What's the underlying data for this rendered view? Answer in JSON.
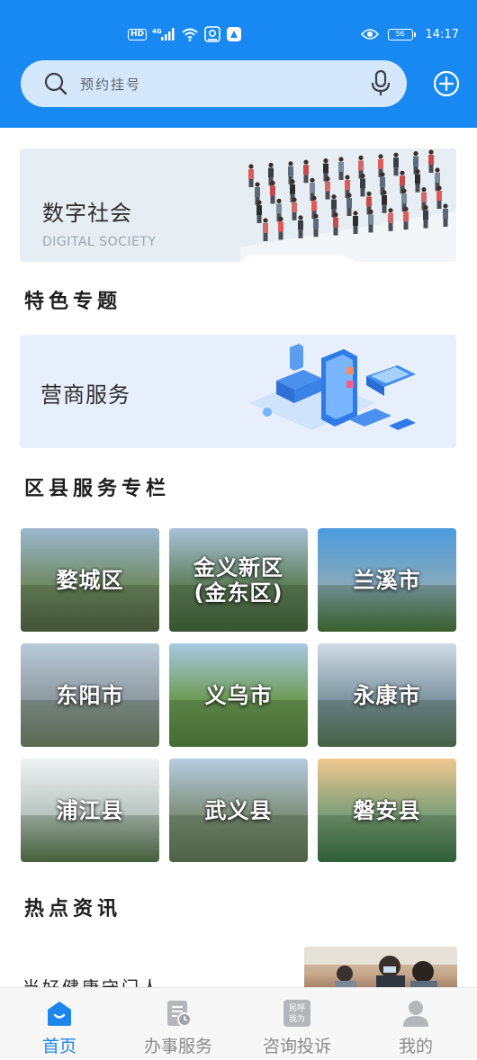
{
  "status_bar": {
    "left_badges": [
      "HD",
      "4G"
    ],
    "time": "14:17",
    "battery": "56"
  },
  "search": {
    "placeholder": "预约挂号"
  },
  "banner_digital": {
    "title": "数字社会",
    "subtitle": "DIGITAL SOCIETY"
  },
  "sections": {
    "featured_title": "特色专题",
    "district_title": "区县服务专栏",
    "news_title": "热点资讯"
  },
  "banner_business": {
    "title": "营商服务"
  },
  "districts": [
    {
      "name": "婺城区",
      "colors": [
        "#9cb7cf",
        "#6f8a63",
        "#4c5a3f"
      ]
    },
    {
      "name": "金义新区\n(金东区)",
      "colors": [
        "#a9c2d8",
        "#5f7f5a",
        "#3f5c37"
      ]
    },
    {
      "name": "兰溪市",
      "colors": [
        "#4b9be0",
        "#86a9b9",
        "#3e6b32"
      ]
    },
    {
      "name": "东阳市",
      "colors": [
        "#b9cad9",
        "#8e9aa0",
        "#6c7a63"
      ]
    },
    {
      "name": "义乌市",
      "colors": [
        "#a8c8e3",
        "#6d9b54",
        "#507a3a"
      ]
    },
    {
      "name": "永康市",
      "colors": [
        "#cfdbe6",
        "#7d95a0",
        "#4e6d55"
      ]
    },
    {
      "name": "浦江县",
      "colors": [
        "#eef2f2",
        "#b8c4c0",
        "#4f6c45"
      ]
    },
    {
      "name": "武义县",
      "colors": [
        "#b6cce0",
        "#7e8f7a",
        "#5d6f55"
      ]
    },
    {
      "name": "磐安县",
      "colors": [
        "#f0c78f",
        "#7a9e78",
        "#2f6b3c"
      ]
    }
  ],
  "news": [
    {
      "title": "当好健康守门人"
    }
  ],
  "tabbar": [
    {
      "label": "首页",
      "icon": "home-icon",
      "active": true
    },
    {
      "label": "办事服务",
      "icon": "document-clock-icon",
      "active": false
    },
    {
      "label": "咨询投诉",
      "icon": "people-voice-icon",
      "badge": "民呼我为",
      "active": false
    },
    {
      "label": "我的",
      "icon": "person-icon",
      "active": false
    }
  ],
  "colors": {
    "brand_blue": "#1889f2",
    "active_tab": "#1b86ec",
    "inactive_tab": "#8a8a8a"
  }
}
